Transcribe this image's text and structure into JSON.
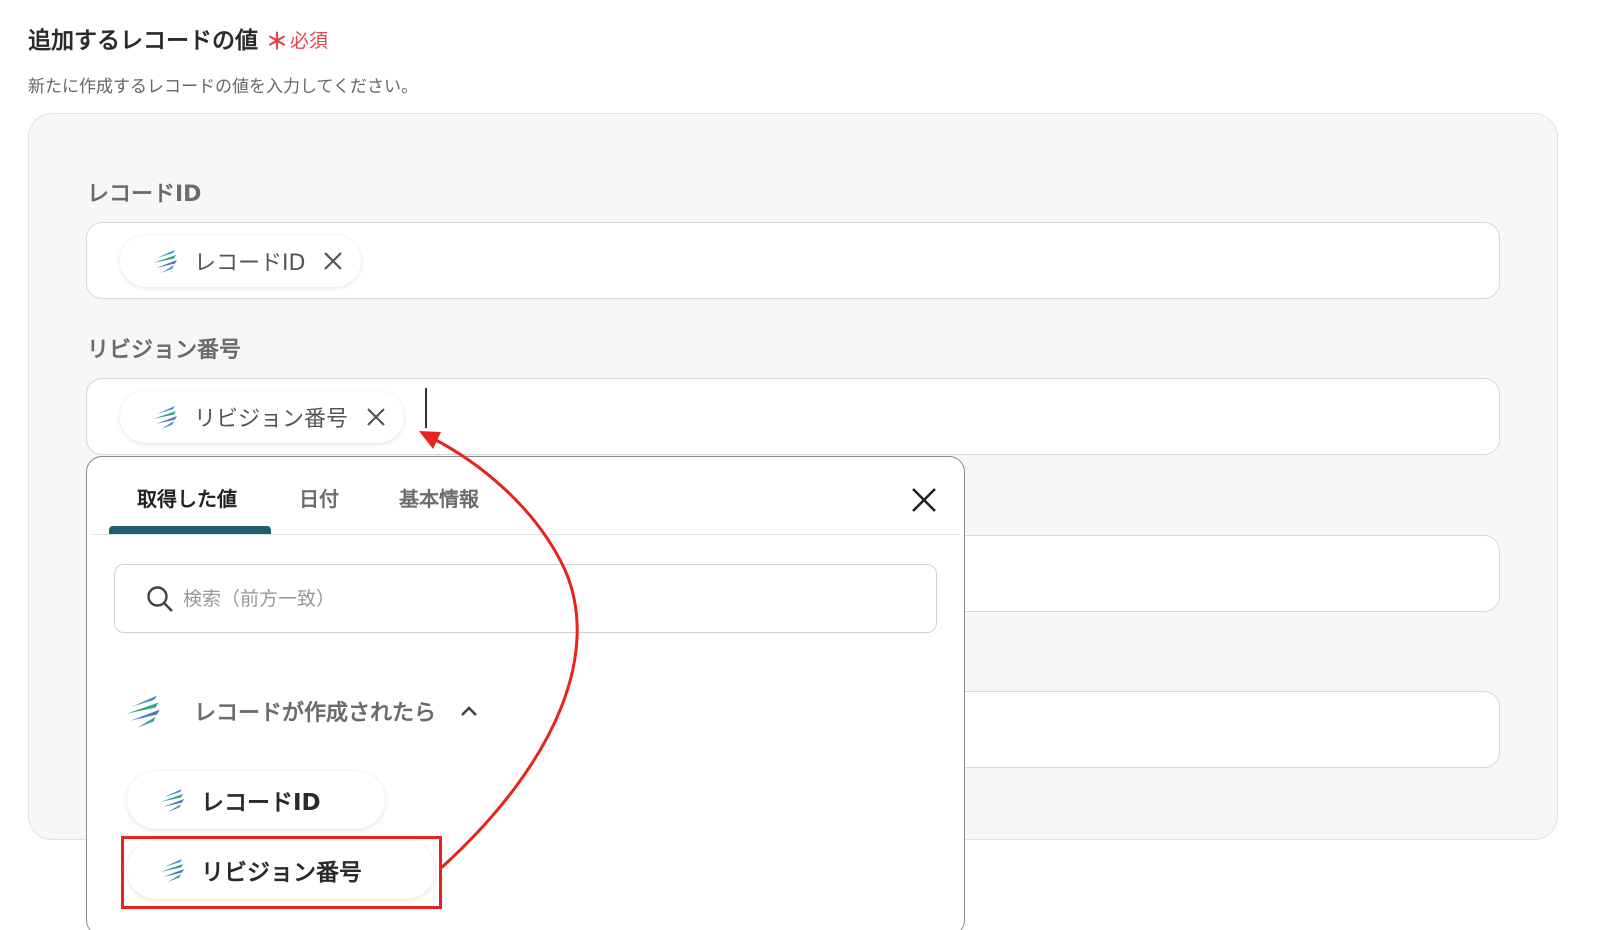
{
  "section": {
    "title": "追加するレコードの値",
    "required_star": "＊",
    "required_label": "必須",
    "description": "新たに作成するレコードの値を入力してください。"
  },
  "fields": [
    {
      "label": "レコードID",
      "chip": "レコードID"
    },
    {
      "label": "リビジョン番号",
      "chip": "リビジョン番号"
    }
  ],
  "dropdown": {
    "tabs": [
      {
        "label": "取得した値",
        "active": true
      },
      {
        "label": "日付",
        "active": false
      },
      {
        "label": "基本情報",
        "active": false
      }
    ],
    "search_placeholder": "検索（前方一致）",
    "group": {
      "title": "レコードが作成されたら",
      "expanded": true,
      "items": [
        "レコードID",
        "リビジョン番号"
      ]
    }
  },
  "icons": {
    "chip_logo": "app-logo-icon",
    "chip_remove": "close-icon",
    "dropdown_close": "close-icon",
    "search": "search-icon",
    "collapse": "chevron-up-icon"
  },
  "colors": {
    "required": "#e4454a",
    "tab_underline": "#1f5e6f",
    "annotation": "#e8231b"
  }
}
